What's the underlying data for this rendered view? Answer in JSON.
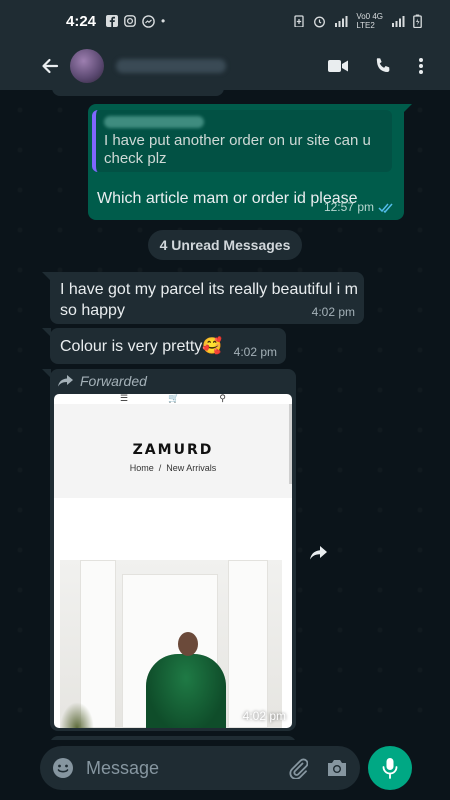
{
  "status_bar": {
    "time": "4:24",
    "network_top": "Vo0 4G",
    "network_bottom": "LTE2"
  },
  "header": {
    "back_icon": "arrow-left-icon",
    "video_icon": "video-call-icon",
    "voice_icon": "phone-icon",
    "menu_icon": "more-vert-icon"
  },
  "messages": {
    "outgoing": {
      "quote_text": "I have put another order on ur site can u check plz",
      "text": "Which article mam or order id please",
      "time": "12:57 pm"
    },
    "unread_banner": "4 Unread Messages",
    "incoming": [
      {
        "text": "I have got my parcel its really beautiful i m so happy",
        "time": "4:02 pm"
      },
      {
        "text": "Colour is very pretty",
        "emoji": "🥰",
        "time": "4:02 pm"
      }
    ],
    "forwarded": {
      "label": "Forwarded",
      "time": "4:02 pm",
      "preview": {
        "brand": "ZAMURD",
        "breadcrumb_home": "Home",
        "breadcrumb_sep": "/",
        "breadcrumb_page": "New Arrivals"
      }
    }
  },
  "composer": {
    "placeholder": "Message"
  },
  "colors": {
    "app_bar": "#1f2c33",
    "outgoing_bubble": "#005c4b",
    "incoming_bubble": "#1f2c33",
    "accent": "#00a884"
  }
}
